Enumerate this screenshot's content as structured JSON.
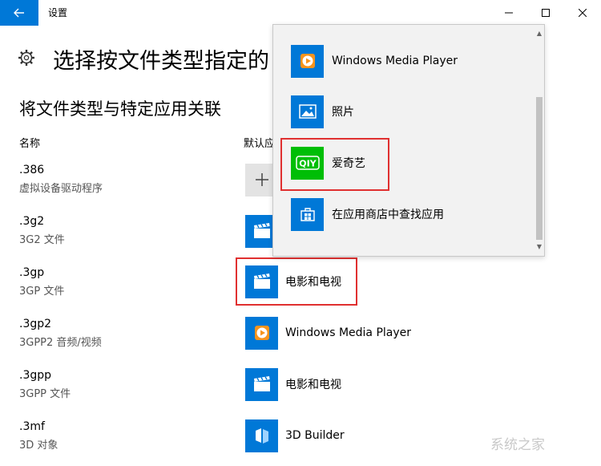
{
  "window": {
    "title": "设置",
    "back_icon": "back-arrow-icon",
    "controls": [
      "minimize-icon",
      "maximize-icon",
      "close-icon"
    ]
  },
  "page": {
    "icon": "gear-icon",
    "title": "选择按文件类型指定的",
    "section_title": "将文件类型与特定应用关联",
    "col_name": "名称",
    "col_default": "默认应"
  },
  "file_types": [
    {
      "ext": ".386",
      "desc": "虚拟设备驱动程序",
      "app": "",
      "app_icon": "plus-icon"
    },
    {
      "ext": ".3g2",
      "desc": "3G2 文件",
      "app": "",
      "app_icon": "movies-tv-icon"
    },
    {
      "ext": ".3gp",
      "desc": "3GP 文件",
      "app": "电影和电视",
      "app_icon": "movies-tv-icon"
    },
    {
      "ext": ".3gp2",
      "desc": "3GPP2 音频/视频",
      "app": "Windows Media Player",
      "app_icon": "media-player-icon"
    },
    {
      "ext": ".3gpp",
      "desc": "3GPP 文件",
      "app": "电影和电视",
      "app_icon": "movies-tv-icon"
    },
    {
      "ext": ".3mf",
      "desc": "3D 对象",
      "app": "3D Builder",
      "app_icon": "3d-builder-icon"
    }
  ],
  "flyout": {
    "items": [
      {
        "label": "Windows Media Player",
        "icon": "media-player-icon"
      },
      {
        "label": "照片",
        "icon": "photos-icon"
      },
      {
        "label": "爱奇艺",
        "icon": "iqiyi-icon"
      },
      {
        "label": "在应用商店中查找应用",
        "icon": "store-icon"
      }
    ]
  },
  "colors": {
    "accent": "#0078d7",
    "highlight": "#e03030",
    "iqiyi_green": "#00be06"
  },
  "watermark": "系统之家"
}
